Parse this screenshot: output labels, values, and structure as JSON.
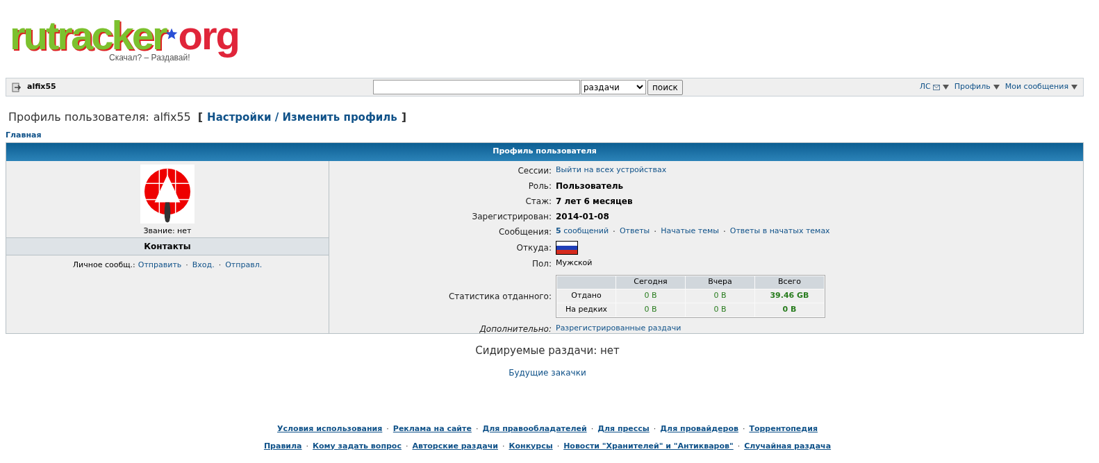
{
  "logo": {
    "part1": "rutracker",
    "part2": "org",
    "tagline": "Скачал? – Раздавай!"
  },
  "nav": {
    "username": "alfix55",
    "category": "раздачи",
    "search_button": "поиск",
    "menus": [
      {
        "label": "ЛС",
        "kind": "mail"
      },
      {
        "label": "Профиль",
        "kind": "plain"
      },
      {
        "label": "Мои сообщения",
        "kind": "plain"
      }
    ]
  },
  "page_title": {
    "prefix": "Профиль пользователя:",
    "username": "alfix55",
    "open_bracket": "[",
    "link": "Настройки / Изменить профиль",
    "close_bracket": "]"
  },
  "breadcrumb": "Главная",
  "profile": {
    "header": "Профиль пользователя",
    "rank": "Звание: нет",
    "contacts_title": "Контакты",
    "contacts": {
      "label": "Личное сообщ.:",
      "links": [
        "Отправить",
        "Вход.",
        "Отправл."
      ],
      "separator": "·"
    },
    "rows": [
      {
        "label": "Сессии:",
        "italic_label": false,
        "kind": "link",
        "value": "Выйти на всех устройствах"
      },
      {
        "label": "Роль:",
        "italic_label": false,
        "kind": "bold",
        "value": "Пользователь"
      },
      {
        "label": "Стаж:",
        "italic_label": false,
        "kind": "bold",
        "value": "7 лет 6 месяцев"
      },
      {
        "label": "Зарегистрирован:",
        "italic_label": false,
        "kind": "bold",
        "value": "2014-01-08"
      },
      {
        "label": "Сообщения:",
        "italic_label": false,
        "kind": "links",
        "links": [
          "**5** сообщений",
          "Ответы",
          "Начатые темы",
          "Ответы в начатых темах"
        ],
        "separator": "·"
      },
      {
        "label": "Откуда:",
        "italic_label": false,
        "kind": "flag"
      },
      {
        "label": "Пол:",
        "italic_label": false,
        "kind": "text",
        "value": "Мужской"
      },
      {
        "label": "Статистика отданного:",
        "italic_label": false,
        "kind": "stats",
        "columns": [
          "Сегодня",
          "Вчера",
          "Всего"
        ],
        "rows": [
          {
            "label": "Отдано",
            "cells": [
              "0 B",
              "0 B",
              "39.46 GB"
            ]
          },
          {
            "label": "На редких",
            "cells": [
              "0 B",
              "0 B",
              "0 B"
            ]
          }
        ]
      },
      {
        "label": "Дополнительно:",
        "italic_label": true,
        "kind": "link",
        "value": "Разрегистрированные раздачи"
      }
    ]
  },
  "seeding": "Сидируемые раздачи: нет",
  "future": "Будущие закачки",
  "footer": {
    "separator": "·",
    "top_links": [
      "Условия использования",
      "Реклама на сайте",
      "Для правообладателей",
      "Для прессы",
      "Для провайдеров",
      "Торрентопедия"
    ],
    "bottom_links": [
      "Правила",
      "Кому задать вопрос",
      "Авторские раздачи",
      "Конкурсы",
      "Новости \"Хранителей\" и \"Антикваров\"",
      "Случайная раздача"
    ]
  }
}
